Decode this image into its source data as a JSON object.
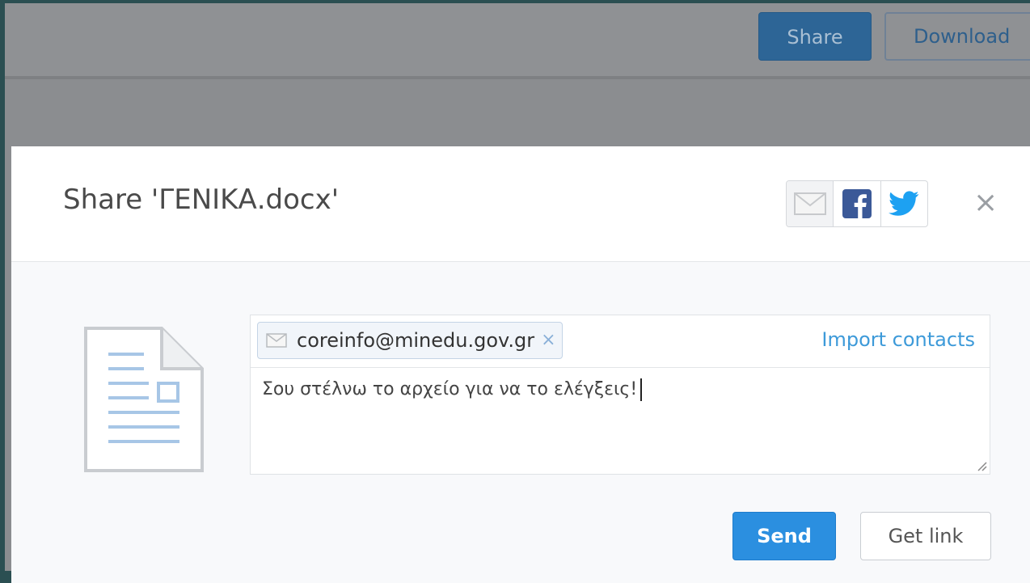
{
  "toolbar": {
    "share_label": "Share",
    "download_label": "Download"
  },
  "modal": {
    "title": "Share 'ΓΕΝΙΚΑ.docx'",
    "social": [
      "email-icon",
      "facebook-icon",
      "twitter-icon"
    ],
    "close_label": "×"
  },
  "compose": {
    "recipient": "coreinfo@minedu.gov.gr",
    "remove_label": "×",
    "import_contacts": "Import contacts",
    "message": "Σου στέλνω το αρχείο για να το ελέγξεις!"
  },
  "actions": {
    "send_label": "Send",
    "get_link_label": "Get link"
  },
  "colors": {
    "accent": "#2b8fe0",
    "link": "#3d9ad9",
    "facebook": "#3b5998",
    "twitter": "#1da1f2"
  }
}
